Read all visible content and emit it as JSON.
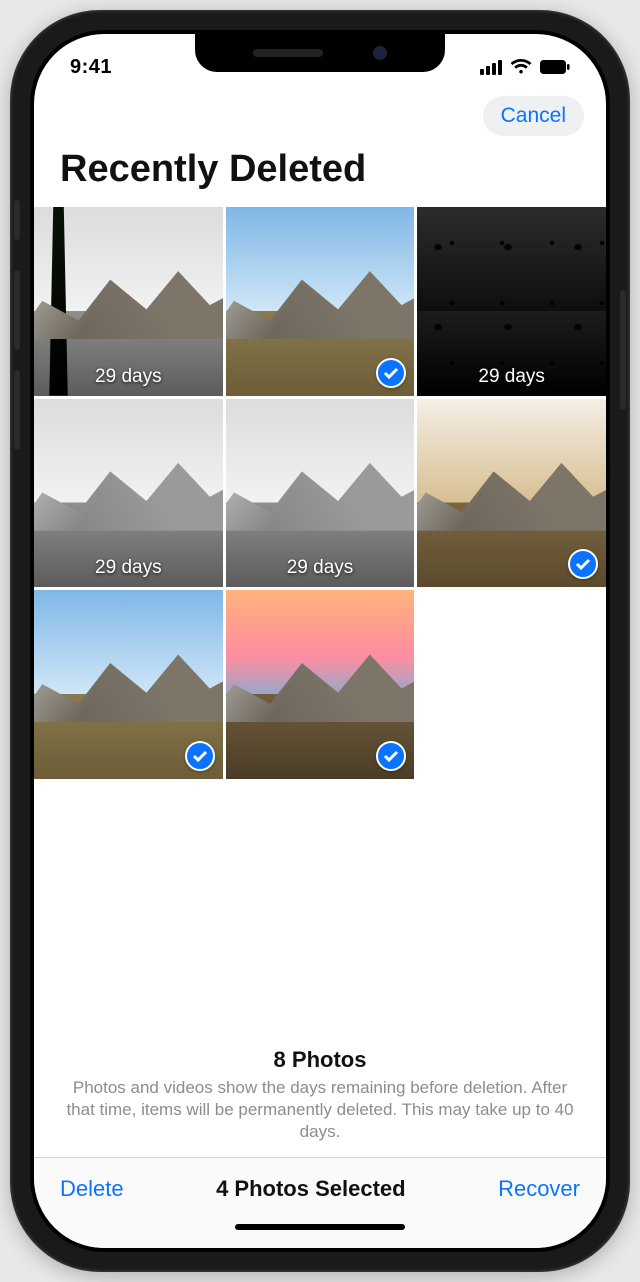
{
  "status": {
    "time": "9:41"
  },
  "nav": {
    "cancel": "Cancel"
  },
  "title": "Recently Deleted",
  "days_label": "29 days",
  "photos": [
    {
      "style": "skybw mtn tree",
      "selected": false,
      "show_days": true,
      "name": "photo-1"
    },
    {
      "style": "sky mtn",
      "selected": true,
      "show_days": false,
      "name": "photo-2"
    },
    {
      "style": "dark plants",
      "selected": false,
      "show_days": true,
      "name": "photo-3"
    },
    {
      "style": "skybw mtn mtnbw",
      "selected": false,
      "show_days": true,
      "name": "photo-4"
    },
    {
      "style": "skybw mtn mtnbw",
      "selected": false,
      "show_days": true,
      "name": "photo-5"
    },
    {
      "style": "cloud mtn",
      "selected": true,
      "show_days": false,
      "name": "photo-6"
    },
    {
      "style": "sky mtn",
      "selected": true,
      "show_days": false,
      "name": "photo-7"
    },
    {
      "style": "sunset mtn",
      "selected": true,
      "show_days": false,
      "name": "photo-8"
    }
  ],
  "info": {
    "count": "8 Photos",
    "desc": "Photos and videos show the days remaining before deletion. After that time, items will be permanently deleted. This may take up to 40 days."
  },
  "toolbar": {
    "delete": "Delete",
    "status": "4 Photos Selected",
    "recover": "Recover"
  }
}
